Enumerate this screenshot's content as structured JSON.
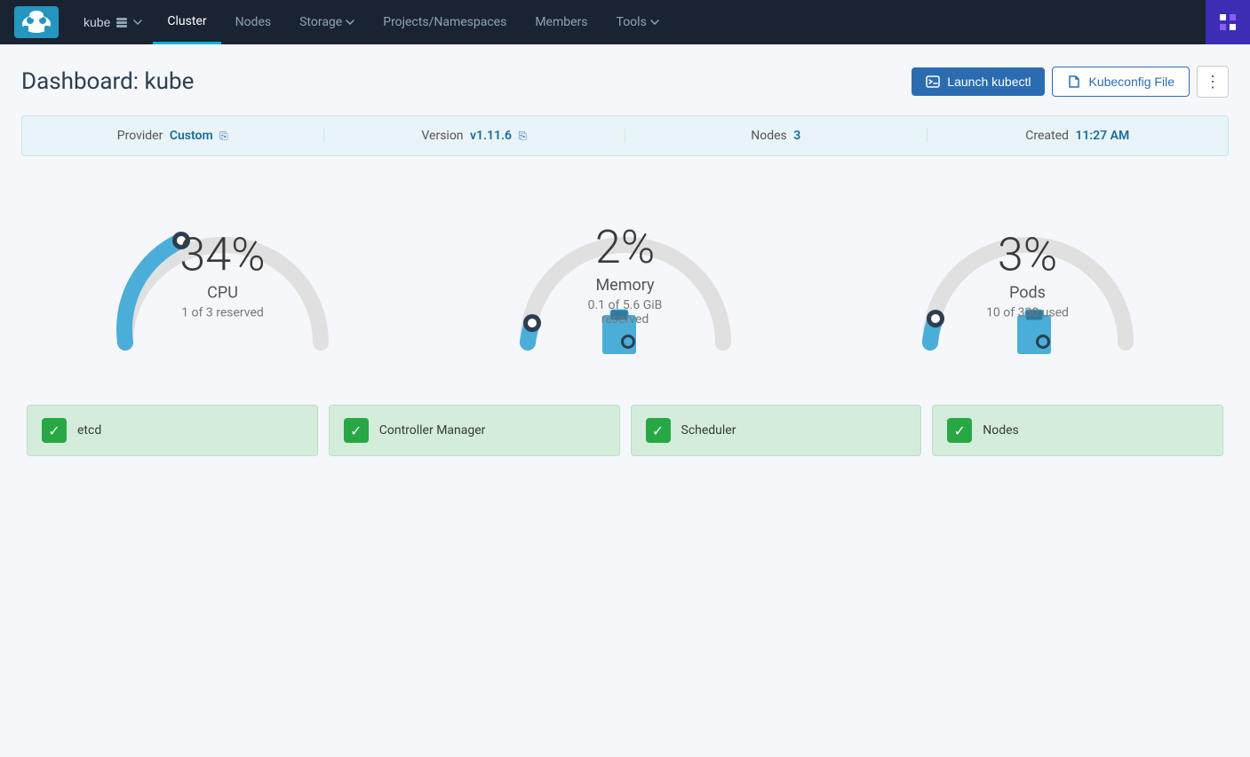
{
  "nav": {
    "logo_alt": "Rancher",
    "cluster_name": "kube",
    "items": [
      {
        "label": "Cluster",
        "active": true
      },
      {
        "label": "Nodes",
        "active": false
      },
      {
        "label": "Storage",
        "active": false,
        "has_arrow": true
      },
      {
        "label": "Projects/Namespaces",
        "active": false
      },
      {
        "label": "Members",
        "active": false
      },
      {
        "label": "Tools",
        "active": false,
        "has_arrow": true
      }
    ]
  },
  "header": {
    "title": "Dashboard: kube",
    "btn_kubectl": "Launch kubectl",
    "btn_kubeconfig": "Kubeconfig File",
    "btn_dots": "⋮"
  },
  "info_bar": {
    "provider_label": "Provider",
    "provider_value": "Custom",
    "version_label": "Version",
    "version_value": "v1.11.6",
    "nodes_label": "Nodes",
    "nodes_value": "3",
    "created_label": "Created",
    "created_value": "11:27 AM"
  },
  "gauges": [
    {
      "id": "cpu",
      "percent": "34%",
      "label": "CPU",
      "sublabel": "1 of 3 reserved",
      "value": 34,
      "color": "#4aaed9",
      "track_color": "#e0e0e0"
    },
    {
      "id": "memory",
      "percent": "2%",
      "label": "Memory",
      "sublabel": "0.1 of 5.6 GiB reserved",
      "value": 2,
      "color": "#4aaed9",
      "track_color": "#e0e0e0"
    },
    {
      "id": "pods",
      "percent": "3%",
      "label": "Pods",
      "sublabel": "10 of 330 used",
      "value": 3,
      "color": "#4aaed9",
      "track_color": "#e0e0e0"
    }
  ],
  "status_items": [
    {
      "label": "etcd",
      "status": "ok"
    },
    {
      "label": "Controller Manager",
      "status": "ok"
    },
    {
      "label": "Scheduler",
      "status": "ok"
    },
    {
      "label": "Nodes",
      "status": "ok"
    }
  ],
  "colors": {
    "nav_bg": "#1a2332",
    "accent": "#00b4d8",
    "gauge_blue": "#4aaed9",
    "status_green": "#28a745",
    "status_bg": "#d4edda"
  }
}
